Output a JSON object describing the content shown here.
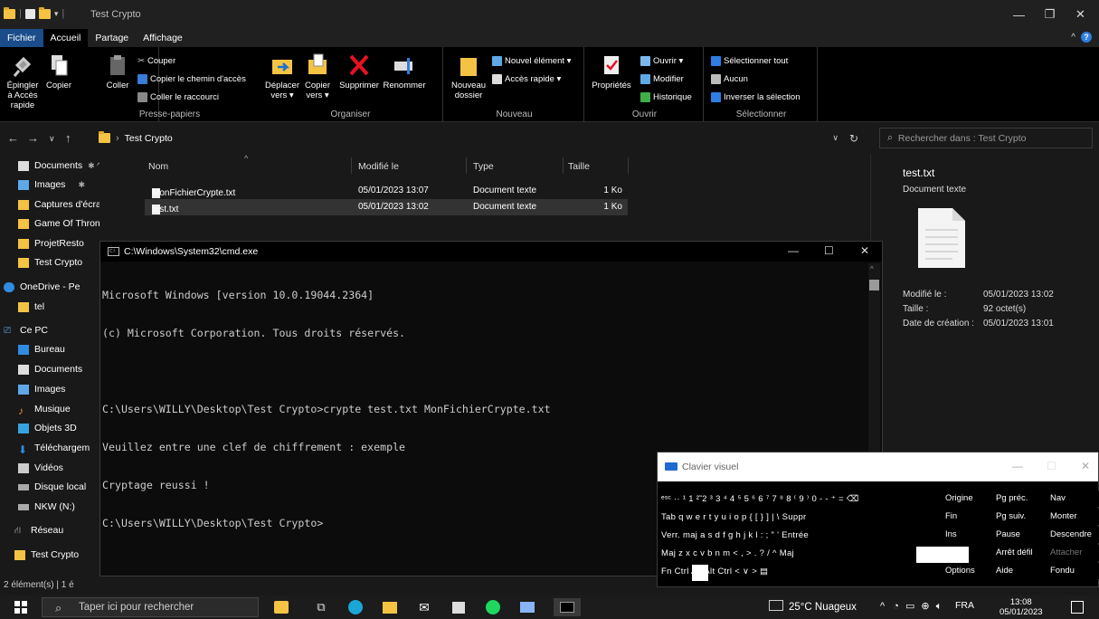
{
  "explorer": {
    "title": "Test Crypto",
    "menu_tabs": [
      "Fichier",
      "Accueil",
      "Partage",
      "Affichage"
    ],
    "ribbon": {
      "presse_papiers": {
        "label": "Presse-papiers",
        "pin": "Épingler à Accès rapide",
        "copy": "Copier",
        "paste": "Coller",
        "cut": "Couper",
        "copy_path": "Copier le chemin d'accès",
        "paste_shortcut": "Coller le raccourci"
      },
      "organiser": {
        "label": "Organiser",
        "move_to": "Déplacer vers ▾",
        "copy_to": "Copier vers ▾",
        "delete": "Supprimer",
        "rename": "Renommer"
      },
      "nouveau": {
        "label": "Nouveau",
        "new_folder": "Nouveau dossier",
        "new_item": "Nouvel élément ▾",
        "quick_access": "Accès rapide ▾"
      },
      "ouvrir": {
        "label": "Ouvrir",
        "properties": "Propriétés",
        "open": "Ouvrir ▾",
        "edit": "Modifier",
        "history": "Historique"
      },
      "selectionner": {
        "label": "Sélectionner",
        "select_all": "Sélectionner tout",
        "select_none": "Aucun",
        "invert": "Inverser la sélection"
      }
    },
    "address_path": "Test Crypto",
    "search_placeholder": "Rechercher dans : Test Crypto",
    "sidebar": [
      {
        "label": "Documents",
        "icon": "documents-icon",
        "color": "#dddddd"
      },
      {
        "label": "Images",
        "icon": "images-icon",
        "color": "#5fa8e8"
      },
      {
        "label": "Captures d'écran",
        "icon": "folder-icon",
        "color": "#f5c344"
      },
      {
        "label": "Game Of Thrones",
        "icon": "folder-icon",
        "color": "#f5c344"
      },
      {
        "label": "ProjetResto",
        "icon": "folder-icon",
        "color": "#f5c344"
      },
      {
        "label": "Test Crypto",
        "icon": "folder-icon",
        "color": "#f5c344"
      },
      {
        "label": "OneDrive - Pe",
        "icon": "onedrive-icon",
        "color": "#2f8ce0"
      },
      {
        "label": "tel",
        "icon": "folder-icon",
        "color": "#f5c344"
      },
      {
        "label": "Ce PC",
        "icon": "pc-icon",
        "color": "#5fa8e8"
      },
      {
        "label": "Bureau",
        "icon": "desktop-icon",
        "color": "#2f8ce0"
      },
      {
        "label": "Documents",
        "icon": "documents-icon",
        "color": "#dddddd"
      },
      {
        "label": "Images",
        "icon": "images-icon",
        "color": "#5fa8e8"
      },
      {
        "label": "Musique",
        "icon": "music-icon",
        "color": "#f08a2c"
      },
      {
        "label": "Objets 3D",
        "icon": "objects3d-icon",
        "color": "#37a2e0"
      },
      {
        "label": "Téléchargem",
        "icon": "download-icon",
        "color": "#2f8ce0"
      },
      {
        "label": "Vidéos",
        "icon": "videos-icon",
        "color": "#cccccc"
      },
      {
        "label": "Disque local",
        "icon": "disk-icon",
        "color": "#aaaaaa"
      },
      {
        "label": "NKW (N:)",
        "icon": "network-drive-icon",
        "color": "#aaaaaa"
      },
      {
        "label": "Réseau",
        "icon": "network-icon",
        "color": "#cccccc"
      },
      {
        "label": "Test Crypto",
        "icon": "folder-icon",
        "color": "#f5c344"
      }
    ],
    "columns": {
      "name": "Nom",
      "modified": "Modifié le",
      "type": "Type",
      "size": "Taille"
    },
    "files": [
      {
        "name": "MonFichierCrypte.txt",
        "modified": "05/01/2023 13:07",
        "type": "Document texte",
        "size": "1 Ko"
      },
      {
        "name": "test.txt",
        "modified": "05/01/2023 13:02",
        "type": "Document texte",
        "size": "1 Ko"
      }
    ],
    "preview": {
      "filename": "test.txt",
      "filetype": "Document texte",
      "modified_label": "Modifié le :",
      "modified_value": "05/01/2023 13:02",
      "size_label": "Taille :",
      "size_value": "92 octet(s)",
      "created_label": "Date de création :",
      "created_value": "05/01/2023 13:01"
    },
    "status": "2 élément(s) | 1 é"
  },
  "cmd": {
    "title": "C:\\Windows\\System32\\cmd.exe",
    "lines": [
      "Microsoft Windows [version 10.0.19044.2364]",
      "(c) Microsoft Corporation. Tous droits réservés.",
      "",
      "C:\\Users\\WILLY\\Desktop\\Test Crypto>crypte test.txt MonFichierCrypte.txt",
      "Veuillez entre une clef de chiffrement : exemple",
      "Cryptage reussi !",
      "C:\\Users\\WILLY\\Desktop\\Test Crypto>"
    ]
  },
  "keyboard": {
    "title": "Clavier visuel",
    "rows": [
      "ᵉˢᶜ  ··  ¹ 1  ²̃ 2  ³ 3  ⁴ 4  ⁵ 5  ⁶ 6  ⁷ 7  ⁸ 8  ⁽ 9  ⁾ 0  ‐ -  ⁺ =   ⌫",
      "Tab   q   w   e   r   t   y   u   i   o   p   {  [   }  ]   |  \\   Suppr",
      "Verr. maj  a   s   d   f   g   h   j   k   l   :  ;   \"  '   Entrée",
      "Maj         z   x   c   v   b   n   m   <  ,   >  .   ?  /   ^   Maj",
      "Fn   Ctrl              Alt                                      Alt   Ctrl   <    ∨    >    ▤"
    ],
    "nav_keys": [
      [
        "Origine",
        "Pg préc.",
        "Nav"
      ],
      [
        "Fin",
        "Pg suiv.",
        "Monter"
      ],
      [
        "Ins",
        "Pause",
        "Descendre"
      ],
      [
        "",
        "Arrêt défil",
        "Attacher"
      ],
      [
        "Options",
        "Aide",
        "Fondu"
      ]
    ]
  },
  "taskbar": {
    "search_placeholder": "Taper ici pour rechercher",
    "weather": "25°C  Nuageux",
    "language": "FRA",
    "time": "13:08",
    "date": "05/01/2023",
    "apps": [
      "explorer-logo-icon",
      "task-view-icon",
      "edge-icon",
      "file-explorer-icon",
      "mail-icon",
      "store-icon",
      "spotify-icon",
      "app-icon",
      "cmd-icon"
    ]
  }
}
